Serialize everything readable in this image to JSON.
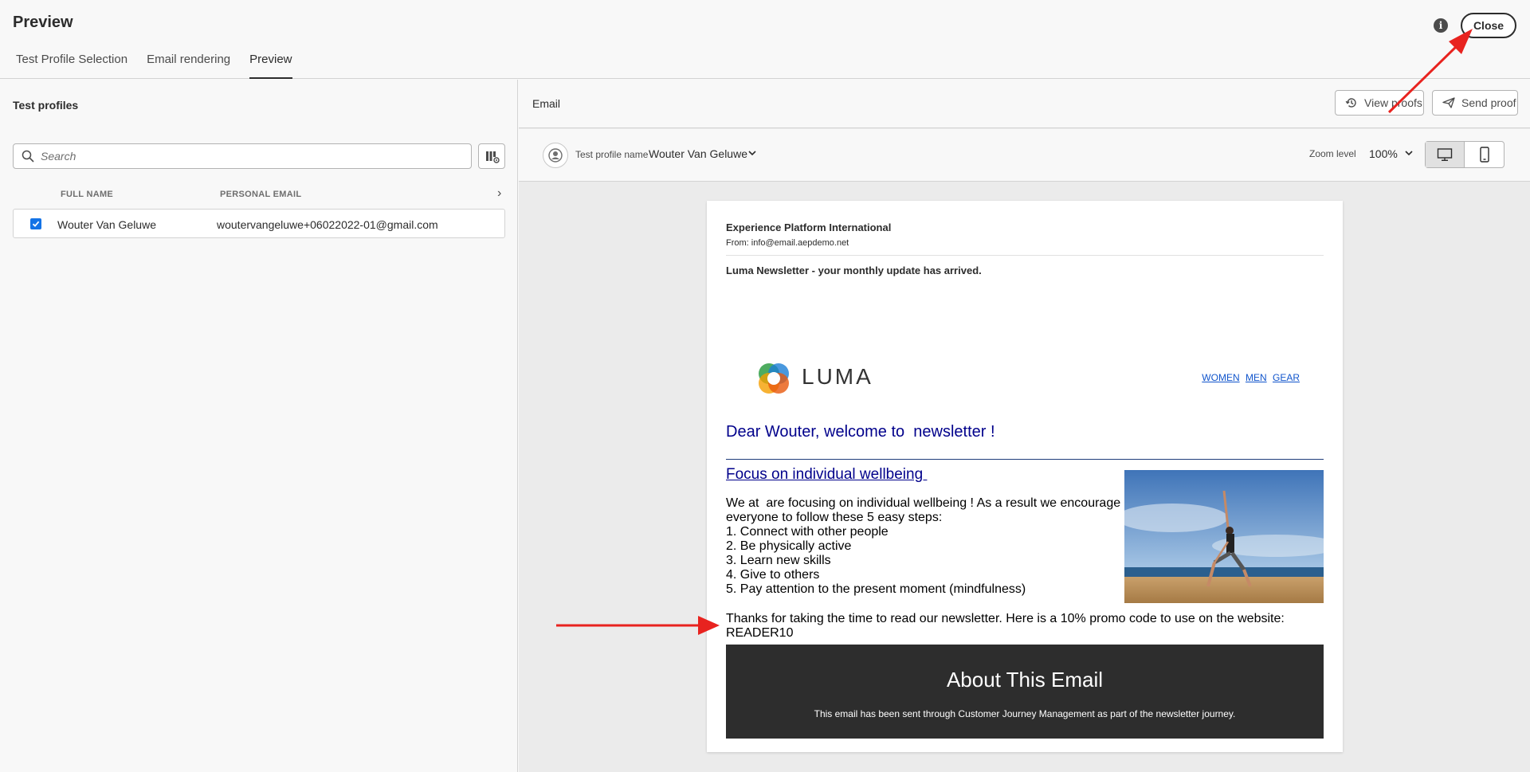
{
  "header": {
    "title": "Preview",
    "tabs": [
      {
        "label": "Test Profile Selection"
      },
      {
        "label": "Email rendering"
      },
      {
        "label": "Preview"
      }
    ],
    "close_label": "Close",
    "info_icon": "info-icon"
  },
  "left_panel": {
    "title": "Test profiles",
    "search": {
      "placeholder": "Search",
      "value": ""
    },
    "columns": [
      "FULL NAME",
      "PERSONAL EMAIL"
    ],
    "rows": [
      {
        "checked": true,
        "full_name": "Wouter Van Geluwe",
        "email": "woutervangeluwe+06022022-01@gmail.com"
      }
    ]
  },
  "right_panel": {
    "title": "Email",
    "view_proofs_label": "View proofs",
    "send_proof_label": "Send proof",
    "profile_label": "Test profile name",
    "profile_value": "Wouter Van Geluwe",
    "zoom_label": "Zoom level",
    "zoom_value": "100%",
    "device_selected": "desktop"
  },
  "email": {
    "sender_name": "Experience Platform International",
    "from": "From: info@email.aepdemo.net",
    "subject": "Luma Newsletter - your monthly update has arrived.",
    "brand": "LUMA",
    "nav_links": [
      "WOMEN",
      "MEN",
      "GEAR"
    ],
    "greeting": "Dear Wouter, welcome to  newsletter !",
    "focus_heading": "Focus on individual wellbeing ",
    "intro": "We at  are focusing on individual wellbeing ! As a result we encourage everyone to follow these 5 easy steps:",
    "steps": [
      "1. Connect with other people",
      "2. Be physically active",
      "3. Learn new skills",
      "4. Give to others",
      "5. Pay attention to the present moment (mindfulness)"
    ],
    "promo": "Thanks for taking the time to read our newsletter. Here is a 10% promo code to use on the website: READER10",
    "footer_title": "About This Email",
    "footer_text": "This email has been sent through Customer Journey Management as part of the newsletter journey."
  },
  "colors": {
    "accent_blue": "#1473e6",
    "annotation_red": "#e8231f",
    "email_heading": "#00008b",
    "footer_dark": "#2d2d2d"
  }
}
